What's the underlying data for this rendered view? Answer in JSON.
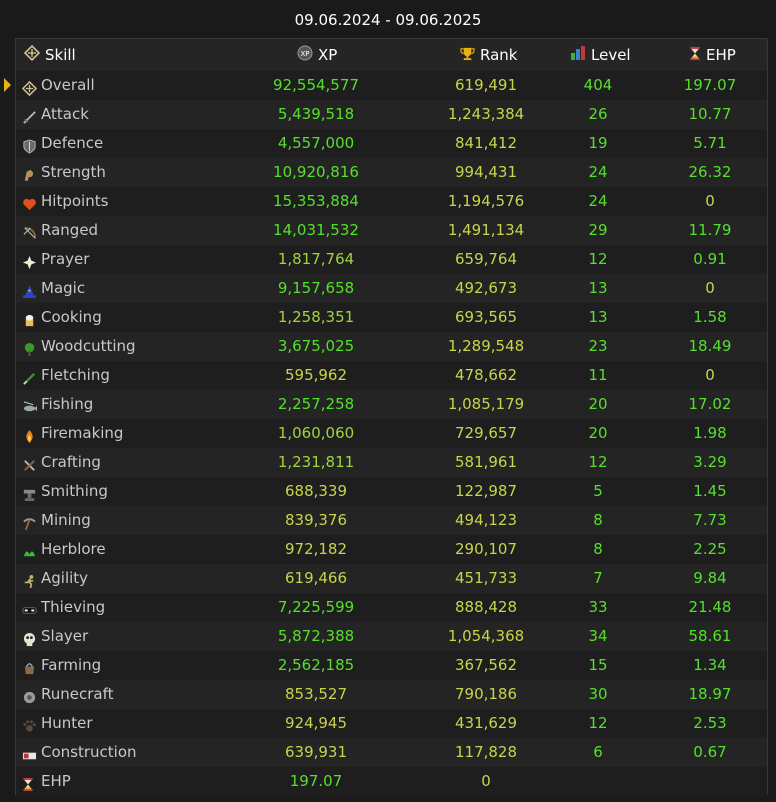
{
  "period": "09.06.2024 - 09.06.2025",
  "colors": {
    "accent_green": "#55e02a",
    "value_yellow": "#c8d44a",
    "pointer": "#e8b010"
  },
  "headers": {
    "skill": "Skill",
    "xp": "XP",
    "rank": "Rank",
    "level": "Level",
    "ehp": "EHP"
  },
  "header_icons": {
    "skill": "stats-icon",
    "xp": "xp-icon",
    "rank": "trophy-icon",
    "level": "level-bars-icon",
    "ehp": "hourglass-icon"
  },
  "rows": [
    {
      "icon": "overall-icon",
      "skill": "Overall",
      "xp": "92,554,577",
      "rank": "619,491",
      "level": "404",
      "ehp": "197.07"
    },
    {
      "icon": "attack-icon",
      "skill": "Attack",
      "xp": "5,439,518",
      "rank": "1,243,384",
      "level": "26",
      "ehp": "10.77"
    },
    {
      "icon": "defence-icon",
      "skill": "Defence",
      "xp": "4,557,000",
      "rank": "841,412",
      "level": "19",
      "ehp": "5.71"
    },
    {
      "icon": "strength-icon",
      "skill": "Strength",
      "xp": "10,920,816",
      "rank": "994,431",
      "level": "24",
      "ehp": "26.32"
    },
    {
      "icon": "hitpoints-icon",
      "skill": "Hitpoints",
      "xp": "15,353,884",
      "rank": "1,194,576",
      "level": "24",
      "ehp": "0"
    },
    {
      "icon": "ranged-icon",
      "skill": "Ranged",
      "xp": "14,031,532",
      "rank": "1,491,134",
      "level": "29",
      "ehp": "11.79"
    },
    {
      "icon": "prayer-icon",
      "skill": "Prayer",
      "xp": "1,817,764",
      "rank": "659,764",
      "level": "12",
      "ehp": "0.91"
    },
    {
      "icon": "magic-icon",
      "skill": "Magic",
      "xp": "9,157,658",
      "rank": "492,673",
      "level": "13",
      "ehp": "0"
    },
    {
      "icon": "cooking-icon",
      "skill": "Cooking",
      "xp": "1,258,351",
      "rank": "693,565",
      "level": "13",
      "ehp": "1.58"
    },
    {
      "icon": "woodcutting-icon",
      "skill": "Woodcutting",
      "xp": "3,675,025",
      "rank": "1,289,548",
      "level": "23",
      "ehp": "18.49"
    },
    {
      "icon": "fletching-icon",
      "skill": "Fletching",
      "xp": "595,962",
      "rank": "478,662",
      "level": "11",
      "ehp": "0"
    },
    {
      "icon": "fishing-icon",
      "skill": "Fishing",
      "xp": "2,257,258",
      "rank": "1,085,179",
      "level": "20",
      "ehp": "17.02"
    },
    {
      "icon": "firemaking-icon",
      "skill": "Firemaking",
      "xp": "1,060,060",
      "rank": "729,657",
      "level": "20",
      "ehp": "1.98"
    },
    {
      "icon": "crafting-icon",
      "skill": "Crafting",
      "xp": "1,231,811",
      "rank": "581,961",
      "level": "12",
      "ehp": "3.29"
    },
    {
      "icon": "smithing-icon",
      "skill": "Smithing",
      "xp": "688,339",
      "rank": "122,987",
      "level": "5",
      "ehp": "1.45"
    },
    {
      "icon": "mining-icon",
      "skill": "Mining",
      "xp": "839,376",
      "rank": "494,123",
      "level": "8",
      "ehp": "7.73"
    },
    {
      "icon": "herblore-icon",
      "skill": "Herblore",
      "xp": "972,182",
      "rank": "290,107",
      "level": "8",
      "ehp": "2.25"
    },
    {
      "icon": "agility-icon",
      "skill": "Agility",
      "xp": "619,466",
      "rank": "451,733",
      "level": "7",
      "ehp": "9.84"
    },
    {
      "icon": "thieving-icon",
      "skill": "Thieving",
      "xp": "7,225,599",
      "rank": "888,428",
      "level": "33",
      "ehp": "21.48"
    },
    {
      "icon": "slayer-icon",
      "skill": "Slayer",
      "xp": "5,872,388",
      "rank": "1,054,368",
      "level": "34",
      "ehp": "58.61"
    },
    {
      "icon": "farming-icon",
      "skill": "Farming",
      "xp": "2,562,185",
      "rank": "367,562",
      "level": "15",
      "ehp": "1.34"
    },
    {
      "icon": "runecraft-icon",
      "skill": "Runecraft",
      "xp": "853,527",
      "rank": "790,186",
      "level": "30",
      "ehp": "18.97"
    },
    {
      "icon": "hunter-icon",
      "skill": "Hunter",
      "xp": "924,945",
      "rank": "431,629",
      "level": "12",
      "ehp": "2.53"
    },
    {
      "icon": "construction-icon",
      "skill": "Construction",
      "xp": "639,931",
      "rank": "117,828",
      "level": "6",
      "ehp": "0.67"
    },
    {
      "icon": "hourglass-icon",
      "skill": "EHP",
      "xp": "197.07",
      "rank": "0",
      "level": "",
      "ehp": ""
    }
  ]
}
